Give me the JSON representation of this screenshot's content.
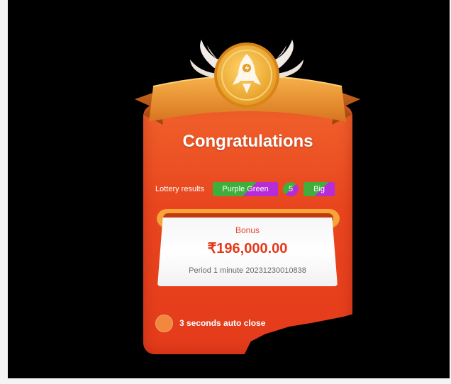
{
  "dialog": {
    "title": "Congratulations",
    "lottery_results_label": "Lottery results",
    "result_color": "Purple Green",
    "result_number": "5",
    "result_size": "Big",
    "bonus_label": "Bonus",
    "bonus_amount": "₹196,000.00",
    "period_text": "Period 1 minute 20231230010838",
    "auto_close_text": "3 seconds auto close"
  },
  "colors": {
    "card_orange": "#e9461f",
    "ribbon_gold": "#f2a23a",
    "medal_gold": "#f6c24b",
    "pill_green": "#3fae3a",
    "pill_purple": "#b62cd6",
    "bonus_red": "#e5381b"
  },
  "icons": {
    "medal": "rocket-icon",
    "wings": "wings-icon",
    "auto_close": "radio-icon"
  }
}
